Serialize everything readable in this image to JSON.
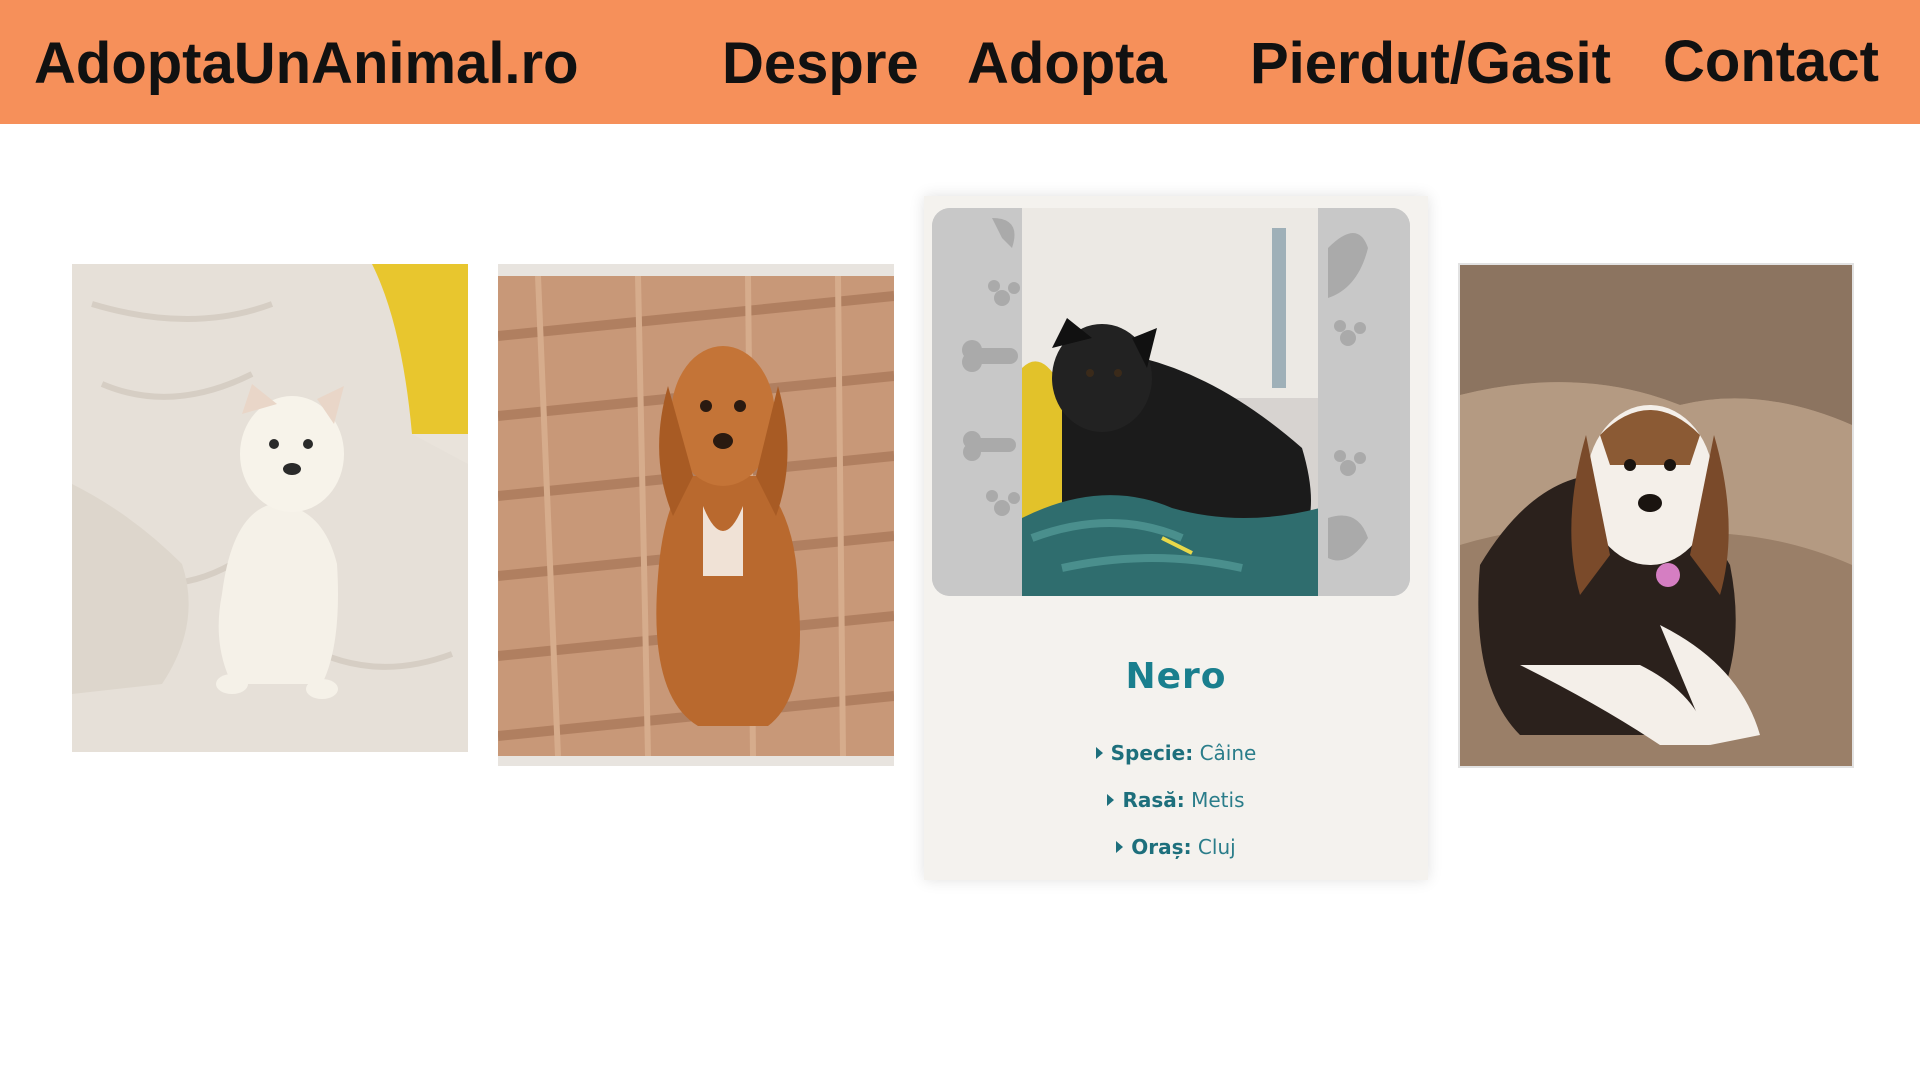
{
  "header": {
    "brand": "AdoptaUnAnimal.ro",
    "nav": [
      "Despre",
      "Adopta",
      "Pierdut/Gasit",
      "Contact"
    ],
    "background": "#f6905a"
  },
  "cards": [
    {
      "photo": "white-puppy-on-sheet"
    },
    {
      "photo": "spaniel-on-wood-floor"
    },
    {
      "photo": "black-dog-on-couch",
      "name": "Nero",
      "attributes": [
        {
          "label": "Specie:",
          "value": "Câine"
        },
        {
          "label": "Rasă:",
          "value": "Metis"
        },
        {
          "label": "Oraș:",
          "value": "Cluj"
        }
      ],
      "accent": "#1a7f8e"
    },
    {
      "photo": "beagle-puppy-on-couch"
    }
  ]
}
